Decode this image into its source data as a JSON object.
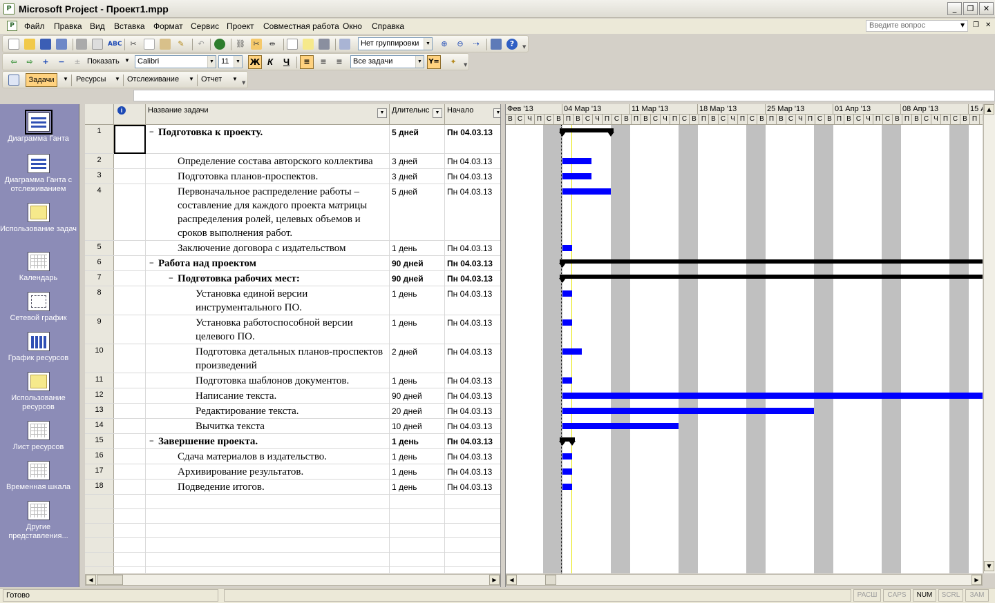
{
  "window": {
    "title": "Microsoft Project - Проект1.mpp",
    "minimize": "_",
    "restore": "❐",
    "close": "✕"
  },
  "menu": {
    "items": [
      "Файл",
      "Правка",
      "Вид",
      "Вставка",
      "Формат",
      "Сервис",
      "Проект",
      "Совместная работа",
      "Окно",
      "Справка"
    ],
    "help_placeholder": "Введите вопрос"
  },
  "toolbars": {
    "grouping": "Нет группировки",
    "show": "Показать",
    "font": "Calibri",
    "font_size": "11",
    "bold": "Ж",
    "italic": "К",
    "underline": "Ч",
    "filter": "Все задачи",
    "guide": {
      "tasks": "Задачи",
      "resources": "Ресурсы",
      "tracking": "Отслеживание",
      "report": "Отчет"
    }
  },
  "view_bar": [
    {
      "label": "Диаграмма Ганта",
      "icon": "gantt-chart-icon",
      "active": true
    },
    {
      "label": "Диаграмма Ганта с отслеживанием",
      "icon": "tracking-gantt-icon",
      "active": false
    },
    {
      "label": "Использование задач",
      "icon": "task-usage-icon",
      "active": false
    },
    {
      "label": "Календарь",
      "icon": "calendar-icon",
      "active": false
    },
    {
      "label": "Сетевой график",
      "icon": "network-diagram-icon",
      "active": false
    },
    {
      "label": "График ресурсов",
      "icon": "resource-graph-icon",
      "active": false
    },
    {
      "label": "Использование ресурсов",
      "icon": "resource-usage-icon",
      "active": false
    },
    {
      "label": "Лист ресурсов",
      "icon": "resource-sheet-icon",
      "active": false
    },
    {
      "label": "Временная шкала",
      "icon": "timeline-icon",
      "active": false
    },
    {
      "label": "Другие представления...",
      "icon": "more-views-icon",
      "active": false
    }
  ],
  "table": {
    "columns": {
      "name": "Название задачи",
      "duration": "Длительнс",
      "start": "Начало"
    },
    "tasks": [
      {
        "id": "1",
        "name": "Подготовка к проекту.",
        "duration": "5 дней",
        "start": "Пн 04.03.13",
        "level": 0,
        "summary": true
      },
      {
        "id": "2",
        "name": "Определение состава авторского коллектива",
        "duration": "3 дней",
        "start": "Пн 04.03.13",
        "level": 1,
        "summary": false
      },
      {
        "id": "3",
        "name": "Подготовка планов-проспектов.",
        "duration": "3 дней",
        "start": "Пн 04.03.13",
        "level": 1,
        "summary": false
      },
      {
        "id": "4",
        "name": "Первоначальное распределение работы – составление для каждого проекта матрицы распределения ролей, целевых объемов и сроков выполнения работ.",
        "duration": "5 дней",
        "start": "Пн 04.03.13",
        "level": 1,
        "summary": false
      },
      {
        "id": "5",
        "name": "Заключение договора с издательством",
        "duration": "1 день",
        "start": "Пн 04.03.13",
        "level": 1,
        "summary": false
      },
      {
        "id": "6",
        "name": "Работа над проектом",
        "duration": "90 дней",
        "start": "Пн 04.03.13",
        "level": 0,
        "summary": true
      },
      {
        "id": "7",
        "name": "Подготовка рабочих мест:",
        "duration": "90 дней",
        "start": "Пн 04.03.13",
        "level": 1,
        "summary": true
      },
      {
        "id": "8",
        "name": "Установка единой версии инструментального ПО.",
        "duration": "1 день",
        "start": "Пн 04.03.13",
        "level": 2,
        "summary": false
      },
      {
        "id": "9",
        "name": "Установка работоспособной версии целевого ПО.",
        "duration": "1 день",
        "start": "Пн 04.03.13",
        "level": 2,
        "summary": false
      },
      {
        "id": "10",
        "name": "Подготовка детальных планов-проспектов произведений",
        "duration": "2 дней",
        "start": "Пн 04.03.13",
        "level": 2,
        "summary": false
      },
      {
        "id": "11",
        "name": "Подготовка шаблонов документов.",
        "duration": "1 день",
        "start": "Пн 04.03.13",
        "level": 2,
        "summary": false
      },
      {
        "id": "12",
        "name": "Написание текста.",
        "duration": "90 дней",
        "start": "Пн 04.03.13",
        "level": 2,
        "summary": false
      },
      {
        "id": "13",
        "name": "Редактирование текста.",
        "duration": "20 дней",
        "start": "Пн 04.03.13",
        "level": 2,
        "summary": false
      },
      {
        "id": "14",
        "name": "Вычитка текста",
        "duration": "10 дней",
        "start": "Пн 04.03.13",
        "level": 2,
        "summary": false
      },
      {
        "id": "15",
        "name": "Завершение проекта.",
        "duration": "1 день",
        "start": "Пн 04.03.13",
        "level": 0,
        "summary": true
      },
      {
        "id": "16",
        "name": "Сдача материалов в издательство.",
        "duration": "1 день",
        "start": "Пн 04.03.13",
        "level": 1,
        "summary": false
      },
      {
        "id": "17",
        "name": "Архивирование результатов.",
        "duration": "1 день",
        "start": "Пн 04.03.13",
        "level": 1,
        "summary": false
      },
      {
        "id": "18",
        "name": "Подведение итогов.",
        "duration": "1 день",
        "start": "Пн 04.03.13",
        "level": 1,
        "summary": false
      }
    ]
  },
  "timescale": {
    "weeks": [
      "Фев '13",
      "04 Мар '13",
      "11 Мар '13",
      "18 Мар '13",
      "25 Мар '13",
      "01 Апр '13",
      "08 Апр '13",
      "15 А"
    ],
    "day_letters": [
      "П",
      "В",
      "С",
      "Ч",
      "П",
      "С",
      "В"
    ]
  },
  "status": {
    "text": "Готово",
    "indicators": [
      {
        "label": "РАСШ",
        "on": false
      },
      {
        "label": "CAPS",
        "on": false
      },
      {
        "label": "NUM",
        "on": true
      },
      {
        "label": "SCRL",
        "on": false
      },
      {
        "label": "ЗАМ",
        "on": false
      }
    ]
  },
  "colors": {
    "task_bar": "#0000ff",
    "summary_bar": "#000000",
    "nonworking": "#c0c0c0",
    "view_bar": "#8c8cb7"
  }
}
